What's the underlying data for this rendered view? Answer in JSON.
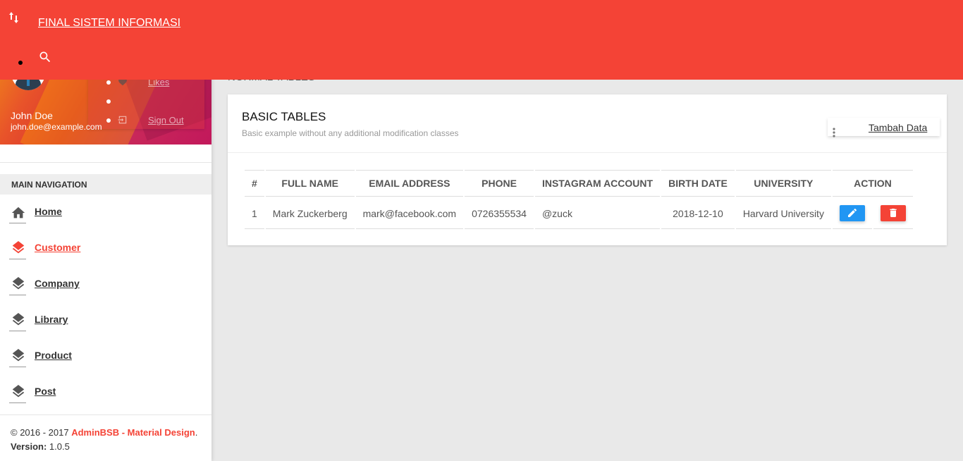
{
  "navbar": {
    "title": "FINAL SISTEM INFORMASI",
    "toggle_icon": "swap-vert-icon",
    "search_icon": "search-icon",
    "color": "#f44336"
  },
  "user": {
    "name": "John Doe",
    "email": "john.doe@example.com",
    "menu": [
      {
        "label": "Likes",
        "icon": "heart-icon"
      },
      {
        "label": "",
        "icon": ""
      },
      {
        "label": "Sign Out",
        "icon": "input-icon"
      }
    ]
  },
  "sidebar": {
    "header": "MAIN NAVIGATION",
    "items": [
      {
        "label": "Home",
        "icon": "home-icon",
        "active": false
      },
      {
        "label": "Customer",
        "icon": "layers-icon",
        "active": true
      },
      {
        "label": "Company",
        "icon": "layers-icon",
        "active": false
      },
      {
        "label": "Library",
        "icon": "layers-icon",
        "active": false
      },
      {
        "label": "Product",
        "icon": "layers-icon",
        "active": false
      },
      {
        "label": "Post",
        "icon": "layers-icon",
        "active": false
      }
    ],
    "footer": {
      "copyright": "© 2016 - 2017 ",
      "brand": "AdminBSB - Material Design",
      "period": ".",
      "version_label": "Version: ",
      "version": "1.0.5"
    }
  },
  "page": {
    "title": "NORMAL TABLES"
  },
  "card": {
    "title": "BASIC TABLES",
    "subtitle": "Basic example without any additional modification classes",
    "dropdown_label": "Tambah Data",
    "dropdown_icon": "more-vert-icon"
  },
  "table": {
    "columns": [
      "#",
      "FULL NAME",
      "EMAIL ADDRESS",
      "PHONE",
      "INSTAGRAM ACCOUNT",
      "BIRTH DATE",
      "UNIVERSITY",
      "ACTION"
    ],
    "rows": [
      {
        "no": "1",
        "name": "Mark Zuckerberg",
        "email": "mark@facebook.com",
        "phone": "0726355534",
        "instagram": "@zuck",
        "birth": "2018-12-10",
        "university": "Harvard University"
      }
    ],
    "edit_icon": "pencil-icon",
    "delete_icon": "trash-icon"
  }
}
